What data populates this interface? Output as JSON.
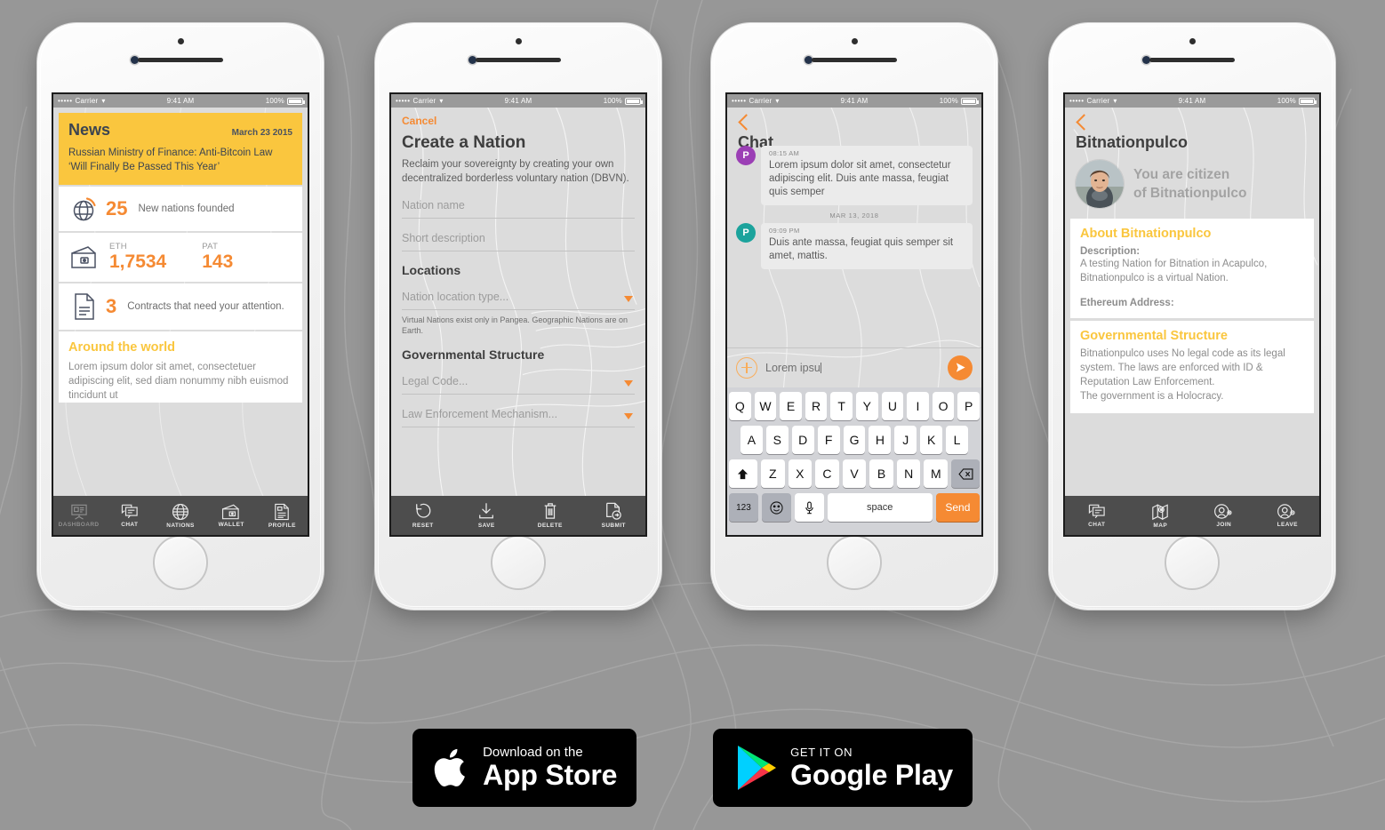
{
  "theme": {
    "background": "#979797",
    "yellow": "#FAC63E",
    "orange": "#F58A33",
    "dark_bar": "#4D4D4D"
  },
  "status_bar": {
    "dots": "•••••",
    "carrier": "Carrier",
    "wifi_icon": "wifi-icon",
    "time": "9:41 AM",
    "battery": "100%"
  },
  "phone1": {
    "screen_name": "dashboard",
    "news": {
      "title": "News",
      "date": "March 23 2015",
      "headline": "Russian Ministry of Finance: Anti-Bitcoin Law ‘Will Finally Be Passed This Year’"
    },
    "stats": [
      {
        "icon": "globe-icon",
        "value": "25",
        "label": "New nations founded"
      },
      {
        "icon": "document-icon",
        "value": "3",
        "label": "Contracts that need your attention."
      }
    ],
    "wallet": {
      "icon": "wallet-icon",
      "columns": [
        {
          "label": "ETH",
          "value": "1,7534"
        },
        {
          "label": "PAT",
          "value": "143"
        }
      ]
    },
    "world": {
      "title": "Around the world",
      "body": "Lorem ipsum dolor sit amet, consectetuer adipiscing elit, sed diam nonummy nibh euismod tincidunt ut"
    },
    "tabs": [
      {
        "label": "DASHBOARD",
        "icon": "dashboard-icon",
        "active": false
      },
      {
        "label": "CHAT",
        "icon": "chat-icon",
        "active": true
      },
      {
        "label": "NATIONS",
        "icon": "globe-icon",
        "active": true
      },
      {
        "label": "WALLET",
        "icon": "wallet-icon",
        "active": true
      },
      {
        "label": "PROFILE",
        "icon": "profile-document-icon",
        "active": true
      }
    ]
  },
  "phone2": {
    "screen_name": "create-a-nation",
    "cancel_label": "Cancel",
    "title": "Create a Nation",
    "lead": "Reclaim your sovereignty by creating your own decentralized borderless voluntary nation (DBVN).",
    "fields": {
      "nation_name_placeholder": "Nation name",
      "short_description_placeholder": "Short description",
      "location_type_placeholder": "Nation location type...",
      "legal_code_placeholder": "Legal Code...",
      "law_enforcement_placeholder": "Law Enforcement Mechanism..."
    },
    "section_locations": "Locations",
    "hint": "Virtual Nations exist only in Pangea. Geographic Nations are on Earth.",
    "section_government": "Governmental Structure",
    "toolbar": [
      {
        "label": "RESET",
        "icon": "undo-icon"
      },
      {
        "label": "SAVE",
        "icon": "save-download-icon"
      },
      {
        "label": "DELETE",
        "icon": "trash-icon"
      },
      {
        "label": "SUBMIT",
        "icon": "submit-document-icon"
      }
    ]
  },
  "phone3": {
    "screen_name": "chat",
    "back_icon": "back-chevron-icon",
    "title": "Chat",
    "messages": [
      {
        "avatar_letter": "P",
        "avatar_color": "#9B3FB5",
        "time": "08:15 AM",
        "text": "Lorem ipsum dolor sit amet, consectetur adipiscing elit. Duis ante massa, feugiat quis semper"
      },
      {
        "avatar_letter": "P",
        "avatar_color": "#1BA39C",
        "time": "09:09 PM",
        "text": "Duis ante massa, feugiat quis semper sit amet, mattis."
      }
    ],
    "day_separator": "MAR 13, 2018",
    "input": {
      "add_icon": "plus-circle-icon",
      "value": "Lorem ipsu",
      "send_icon": "send-arrow-icon"
    },
    "keyboard": {
      "row1": [
        "Q",
        "W",
        "E",
        "R",
        "T",
        "Y",
        "U",
        "I",
        "O",
        "P"
      ],
      "row2": [
        "A",
        "S",
        "D",
        "F",
        "G",
        "H",
        "J",
        "K",
        "L"
      ],
      "row3_shift": "⬆",
      "row3": [
        "Z",
        "X",
        "C",
        "V",
        "B",
        "N",
        "M"
      ],
      "row3_backspace": "⌫",
      "numbers_key": "123",
      "emoji_key": "emoji-icon",
      "mic_key": "mic-icon",
      "space_key": "space",
      "send_key": "Send"
    }
  },
  "phone4": {
    "screen_name": "nation-profile",
    "back_icon": "back-chevron-icon",
    "title": "Bitnationpulco",
    "avatar": "user-photo-avatar",
    "citizen_line1": "You are citizen",
    "citizen_line2": "of Bitnationpulco",
    "about": {
      "heading": "About Bitnationpulco",
      "description_label": "Description:",
      "description": "A testing Nation for Bitnation in Acapulco, Bitnationpulco is a virtual Nation.",
      "ethereum_label": "Ethereum Address:"
    },
    "government": {
      "heading": "Governmental Structure",
      "body": "Bitnationpulco uses No legal code as its legal system. The laws are enforced with ID & Reputation Law Enforcement.",
      "body2": "The government is a Holocracy."
    },
    "tabs": [
      {
        "label": "CHAT",
        "icon": "chat-icon"
      },
      {
        "label": "MAP",
        "icon": "map-pin-icon"
      },
      {
        "label": "JOIN",
        "icon": "person-add-icon"
      },
      {
        "label": "LEAVE",
        "icon": "person-remove-icon"
      }
    ]
  },
  "store_badges": {
    "apple": {
      "icon": "apple-logo-icon",
      "small": "Download on the",
      "large": "App Store"
    },
    "google": {
      "icon": "google-play-icon",
      "small": "GET IT ON",
      "large": "Google Play"
    }
  }
}
